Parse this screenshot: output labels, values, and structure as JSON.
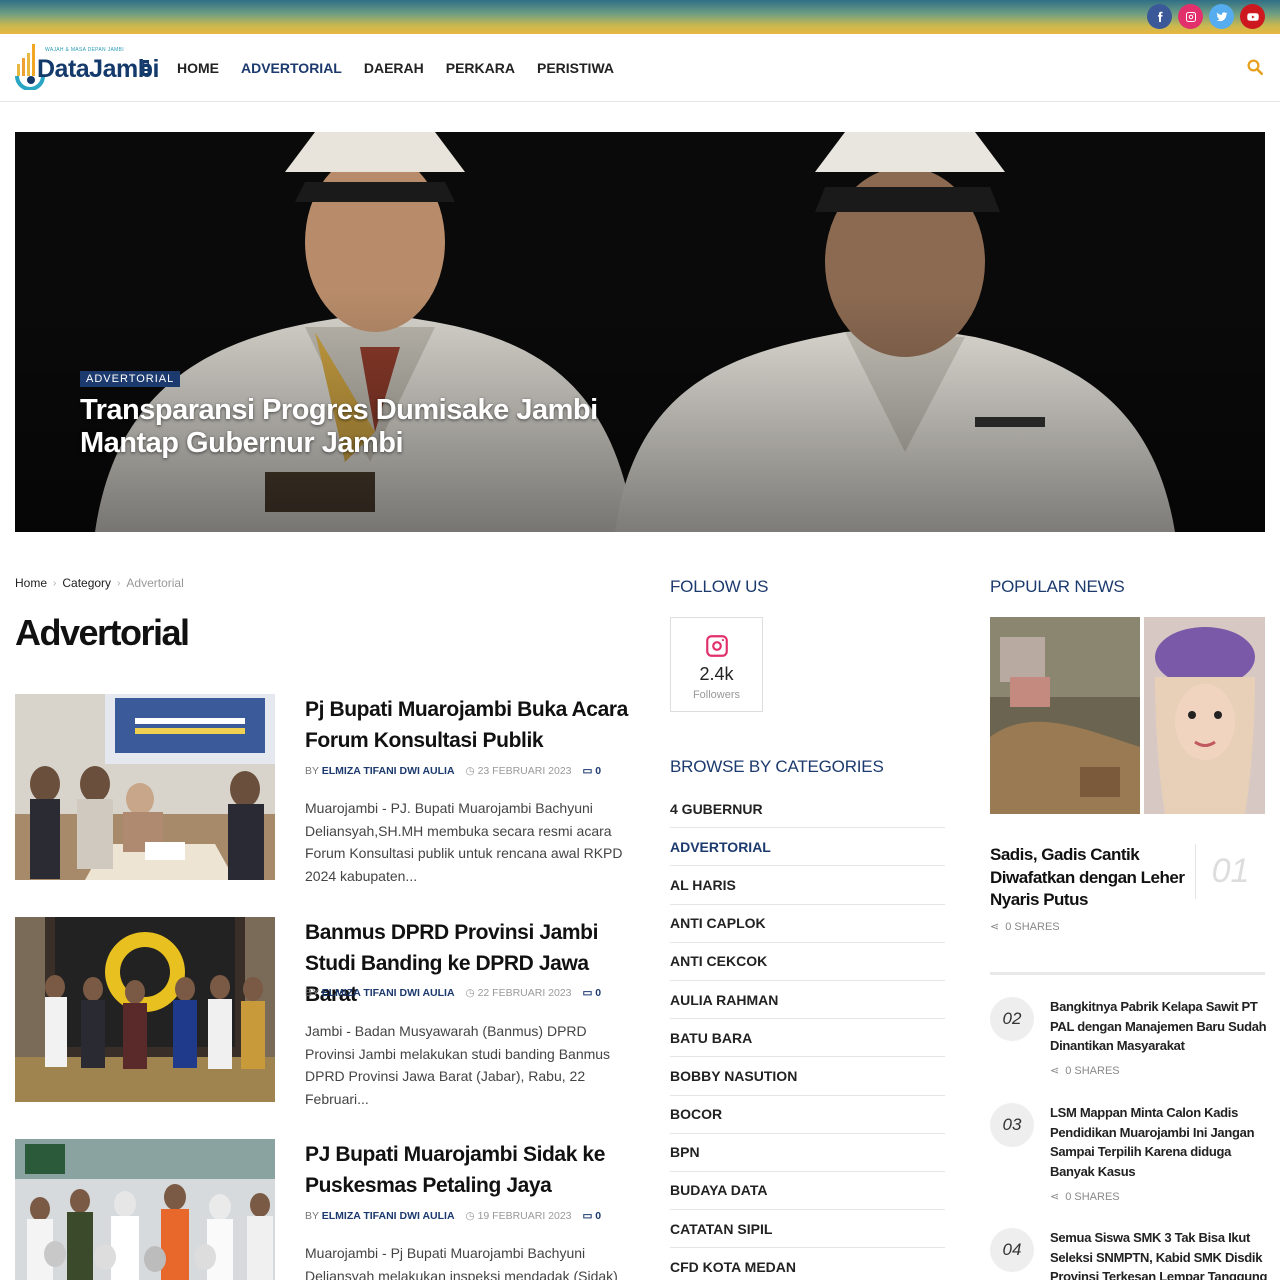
{
  "header": {
    "logo_tagline": "WAJAH & MASA DEPAN JAMBI",
    "logo_text": "DataJambi",
    "nav": [
      {
        "label": "HOME",
        "active": false
      },
      {
        "label": "ADVERTORIAL",
        "active": true
      },
      {
        "label": "DAERAH",
        "active": false
      },
      {
        "label": "PERKARA",
        "active": false
      },
      {
        "label": "PERISTIWA",
        "active": false
      }
    ],
    "social": [
      {
        "name": "facebook-icon",
        "color": "#3b5998"
      },
      {
        "name": "instagram-icon",
        "color": "#e1306c"
      },
      {
        "name": "twitter-icon",
        "color": "#55acee"
      },
      {
        "name": "youtube-icon",
        "color": "#cc181e"
      }
    ]
  },
  "hero": {
    "category": "ADVERTORIAL",
    "title": "Transparansi Progres Dumisake Jambi Mantap Gubernur Jambi"
  },
  "breadcrumb": {
    "home": "Home",
    "category": "Category",
    "current": "Advertorial"
  },
  "page_title": "Advertorial",
  "articles": [
    {
      "title": "Pj Bupati Muarojambi Buka Acara Forum Konsultasi Publik",
      "by": "BY",
      "author": "ELMIZA TIFANI DWI AULIA",
      "date": "23 FEBRUARI 2023",
      "comments": "0",
      "excerpt": "Muarojambi - PJ. Bupati Muarojambi Bachyuni Deliansyah,SH.MH membuka secara resmi acara Forum Konsultasi publik untuk rencana awal RKPD 2024 kabupaten..."
    },
    {
      "title": "Banmus DPRD Provinsi Jambi Studi Banding ke DPRD Jawa Barat",
      "by": "BY",
      "author": "ELMIZA TIFANI DWI AULIA",
      "date": "22 FEBRUARI 2023",
      "comments": "0",
      "excerpt": "Jambi - Badan Musyawarah (Banmus) DPRD Provinsi Jambi melakukan studi banding Banmus DPRD Provinsi Jawa Barat (Jabar), Rabu, 22 Februari..."
    },
    {
      "title": "PJ Bupati Muarojambi Sidak ke Puskesmas Petaling Jaya",
      "by": "BY",
      "author": "ELMIZA TIFANI DWI AULIA",
      "date": "19 FEBRUARI 2023",
      "comments": "0",
      "excerpt": "Muarojambi - Pj Bupati Muarojambi Bachyuni Deliansyah melakukan inspeksi mendadak (Sidak)"
    }
  ],
  "follow": {
    "title": "FOLLOW US",
    "count": "2.4k",
    "label": "Followers"
  },
  "categories": {
    "title": "BROWSE BY CATEGORIES",
    "items": [
      {
        "label": "4 GUBERNUR",
        "active": false
      },
      {
        "label": "ADVERTORIAL",
        "active": true
      },
      {
        "label": "AL HARIS",
        "active": false
      },
      {
        "label": "ANTI CAPLOK",
        "active": false
      },
      {
        "label": "ANTI CEKCOK",
        "active": false
      },
      {
        "label": "AULIA RAHMAN",
        "active": false
      },
      {
        "label": "BATU BARA",
        "active": false
      },
      {
        "label": "BOBBY NASUTION",
        "active": false
      },
      {
        "label": "BOCOR",
        "active": false
      },
      {
        "label": "BPN",
        "active": false
      },
      {
        "label": "BUDAYA DATA",
        "active": false
      },
      {
        "label": "CATATAN SIPIL",
        "active": false
      },
      {
        "label": "CFD KOTA MEDAN",
        "active": false
      }
    ]
  },
  "popular": {
    "title": "POPULAR NEWS",
    "items": [
      {
        "num": "01",
        "title": "Sadis, Gadis Cantik Diwafatkan dengan Leher Nyaris Putus",
        "shares": "0 SHARES"
      },
      {
        "num": "02",
        "title": "Bangkitnya Pabrik Kelapa Sawit PT PAL dengan Manajemen Baru Sudah Dinantikan Masyarakat",
        "shares": "0 SHARES"
      },
      {
        "num": "03",
        "title": "LSM Mappan Minta Calon Kadis Pendidikan Muarojambi Ini Jangan Sampai Terpilih Karena diduga Banyak Kasus",
        "shares": "0 SHARES"
      },
      {
        "num": "04",
        "title": "Semua Siswa SMK 3 Tak Bisa Ikut Seleksi SNMPTN, Kabid SMK Disdik Provinsi Terkesan Lempar Tanggung"
      }
    ]
  }
}
